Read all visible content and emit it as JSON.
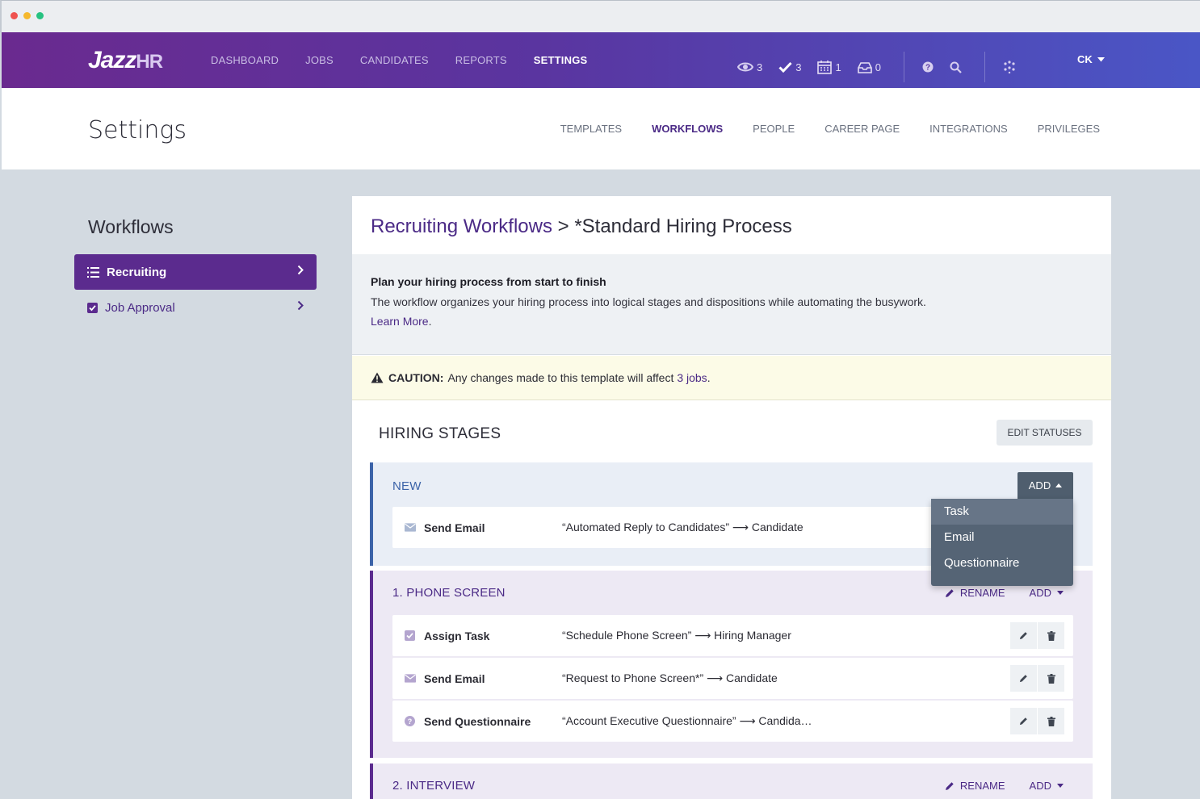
{
  "nav": {
    "logo_main": "Jazz",
    "logo_accent": "HR",
    "links": [
      "DASHBOARD",
      "JOBS",
      "CANDIDATES",
      "REPORTS",
      "SETTINGS"
    ],
    "active": "SETTINGS",
    "counters": {
      "views": "3",
      "tasks": "3",
      "calendar": "1",
      "inbox": "0"
    },
    "user": "CK"
  },
  "settings": {
    "title": "Settings",
    "tabs": [
      "TEMPLATES",
      "WORKFLOWS",
      "PEOPLE",
      "CAREER PAGE",
      "INTEGRATIONS",
      "PRIVILEGES"
    ],
    "active_tab": "WORKFLOWS"
  },
  "sidebar": {
    "title": "Workflows",
    "items": [
      {
        "label": "Recruiting",
        "active": true
      },
      {
        "label": "Job Approval",
        "active": false
      }
    ]
  },
  "main": {
    "breadcrumb_link": "Recruiting Workflows",
    "breadcrumb_sep": ">",
    "breadcrumb_current": "*Standard Hiring Process",
    "info_heading": "Plan your hiring process from start to finish",
    "info_text": "The workflow organizes your hiring process into logical stages and dispositions while automating the busywork.",
    "learn_more": "Learn More",
    "caution_label": "CAUTION:",
    "caution_text": "Any changes made to this template will affect",
    "caution_jobs": "3 jobs",
    "hiring_stages_title": "HIRING STAGES",
    "edit_statuses": "EDIT STATUSES"
  },
  "stages": [
    {
      "name": "NEW",
      "actions": {
        "add": "ADD"
      },
      "rows": [
        {
          "icon": "envelope-icon",
          "label": "Send Email",
          "value": "“Automated Reply to Candidates” ⟶ Candidate"
        }
      ]
    },
    {
      "name": "1. PHONE SCREEN",
      "actions": {
        "rename": "RENAME",
        "add": "ADD"
      },
      "rows": [
        {
          "icon": "checkbox-icon",
          "label": "Assign Task",
          "value": "“Schedule Phone Screen” ⟶ Hiring Manager"
        },
        {
          "icon": "envelope-icon",
          "label": "Send Email",
          "value": "“Request to Phone Screen*” ⟶ Candidate"
        },
        {
          "icon": "question-icon",
          "label": "Send Questionnaire",
          "value": "“Account Executive Questionnaire” ⟶ Candida…"
        }
      ]
    },
    {
      "name": "2. INTERVIEW",
      "actions": {
        "rename": "RENAME",
        "add": "ADD"
      },
      "rows": []
    }
  ],
  "add_dropdown": {
    "options": [
      "Task",
      "Email",
      "Questionnaire"
    ],
    "highlighted": "Task"
  },
  "colors": {
    "brand_purple": "#5b2b8e",
    "brand_blue": "#3c63a8",
    "dot_red": "#ef5350",
    "dot_yellow": "#f5b82e",
    "dot_green": "#27c281"
  }
}
